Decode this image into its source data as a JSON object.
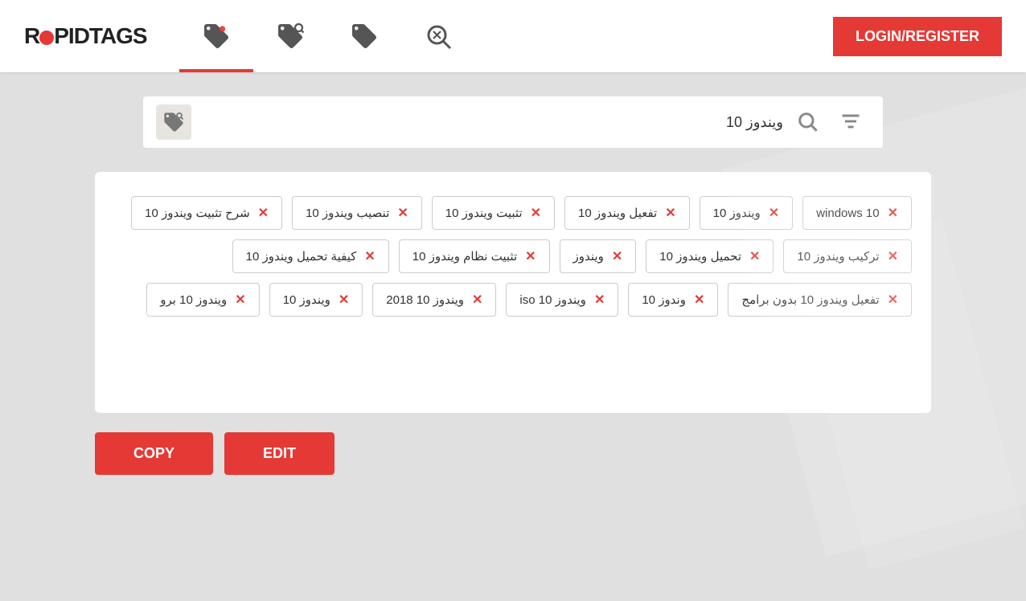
{
  "header": {
    "logo_text": "RAPIDTAGS",
    "login_label": "LOGIN/REGISTER",
    "nav_items": [
      {
        "id": "tag-gen",
        "label": "Tag Generator",
        "active": true
      },
      {
        "id": "tag-extractor",
        "label": "Tag Extractor",
        "active": false
      },
      {
        "id": "tag-rank",
        "label": "Tag Rank",
        "active": false
      },
      {
        "id": "search-rank",
        "label": "Search Rank",
        "active": false
      }
    ]
  },
  "search": {
    "value": "ويندوز 10",
    "placeholder": "ويندوز 10"
  },
  "tags": [
    {
      "text": "windows 10"
    },
    {
      "text": "ويندوز 10"
    },
    {
      "text": "تفعيل ويندوز 10"
    },
    {
      "text": "تثبيت ويندوز 10"
    },
    {
      "text": "تنصيب ويندوز 10"
    },
    {
      "text": "شرح تثبيت ويندوز 10"
    },
    {
      "text": "تركيب ويندوز 10"
    },
    {
      "text": "تحميل ويندوز 10"
    },
    {
      "text": "ويندوز"
    },
    {
      "text": "تثبيت نظام ويندوز 10"
    },
    {
      "text": "كيفية تحميل ويندوز 10"
    },
    {
      "text": "تفعيل ويندوز 10 بدون برامج"
    },
    {
      "text": "وندوز 10"
    },
    {
      "text": "ويندوز 10 iso"
    },
    {
      "text": "ويندوز 10 2018"
    },
    {
      "text": "ويندوز 10"
    },
    {
      "text": "ويندوز 10 برو"
    }
  ],
  "buttons": {
    "copy_label": "COPY",
    "edit_label": "EDIT"
  }
}
